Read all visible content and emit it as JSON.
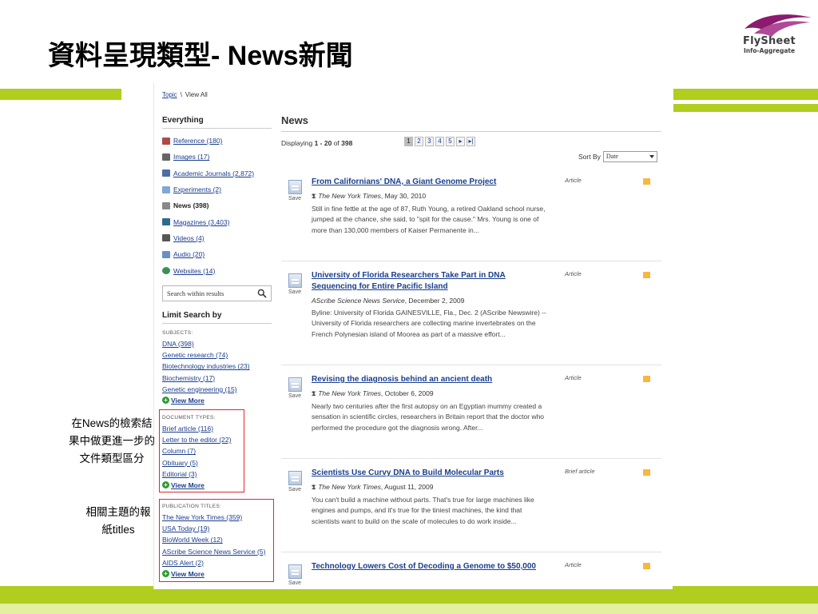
{
  "slide": {
    "title_cjk": "資料呈現類型",
    "title_latin": "- News",
    "title_cjk2": "新聞",
    "logo_name": "FlySheet",
    "logo_sub": "Info-Aggregate",
    "colors": {
      "bar": "#b1cd1e",
      "bar_light": "#e4ef9f",
      "logo": "#8c1a6e",
      "annotation_box": "#e0282c"
    }
  },
  "crumb": {
    "link": "Topic",
    "sep": "\\",
    "current": "View All"
  },
  "rail": {
    "title": "Everything",
    "items": [
      {
        "label": "Reference (180)",
        "icon": "reference-icon"
      },
      {
        "label": "Images (17)",
        "icon": "camera-icon"
      },
      {
        "label": "Academic Journals (2,872)",
        "icon": "journal-icon"
      },
      {
        "label": "Experiments (2)",
        "icon": "flask-icon"
      },
      {
        "label": "News (398)",
        "icon": "news-icon",
        "current": true
      },
      {
        "label": "Magazines (3,403)",
        "icon": "magazine-icon"
      },
      {
        "label": "Videos (4)",
        "icon": "video-icon"
      },
      {
        "label": "Audio (20)",
        "icon": "speaker-icon"
      },
      {
        "label": "Websites (14)",
        "icon": "globe-icon"
      }
    ]
  },
  "search": {
    "placeholder": "Search within results"
  },
  "limit": {
    "title": "Limit Search by",
    "subjects_head": "SUBJECTS:",
    "subjects": [
      "DNA (398)",
      "Genetic research (74)",
      "Biotechnology industries (23)",
      "Biochemistry (17)",
      "Genetic engineering (15)"
    ],
    "more": "View More",
    "doctypes_head": "DOCUMENT TYPES:",
    "doctypes": [
      "Brief article (116)",
      "Letter to the editor (22)",
      "Column (7)",
      "Obituary (5)",
      "Editorial (3)"
    ],
    "pubs_head": "PUBLICATION TITLES:",
    "pubs": [
      "The New York Times (359)",
      "USA Today (19)",
      "BioWorld Week (12)",
      "AScribe Science News Service (5)",
      "AIDS Alert (2)"
    ]
  },
  "main": {
    "heading": "News",
    "displaying_prefix": "Displaying ",
    "displaying_range": "1 - 20",
    "displaying_of": " of ",
    "displaying_total": "398",
    "pages": [
      "1",
      "2",
      "3",
      "4",
      "5",
      "▸",
      "▸|"
    ],
    "sort_label": "Sort By",
    "sort_value": "Date",
    "save_label": "Save",
    "results": [
      {
        "title": "From Californians' DNA, a Giant Genome Project",
        "source": "The New York Times",
        "date": ", May 30, 2010",
        "nyt": true,
        "abstract": "Still in fine fettle at the age of 87, Ruth Young, a retired Oakland school nurse, jumped at the chance, she said, to \"spit for the cause.\" Mrs. Young is one of more than 130,000 members of Kaiser Permanente in...",
        "kind": "Article"
      },
      {
        "title": "University of Florida Researchers Take Part in DNA Sequencing for Entire Pacific Island",
        "source": "AScribe Science News Service",
        "date": ", December 2, 2009",
        "nyt": false,
        "abstract": "Byline: University of Florida GAINESVILLE, Fla., Dec. 2 (AScribe Newswire) -- University of Florida researchers are collecting marine invertebrates on the French Polynesian island of Moorea as part of a massive effort...",
        "kind": "Article"
      },
      {
        "title": "Revising the diagnosis behind an ancient death",
        "source": "The New York Times",
        "date": ", October 6, 2009",
        "nyt": true,
        "abstract": "Nearly two centuries after the first autopsy on an Egyptian mummy created a sensation in scientific circles, researchers in Britain report that the doctor who performed the procedure got the diagnosis wrong. After...",
        "kind": "Article"
      },
      {
        "title": "Scientists Use Curvy DNA to Build Molecular Parts",
        "source": "The New York Times",
        "date": ", August 11, 2009",
        "nyt": true,
        "abstract": "You can't build a machine without parts. That's true for large machines like engines and pumps, and it's true for the tiniest machines, the kind that scientists want to build on the scale of molecules to do work inside...",
        "kind": "Brief article"
      },
      {
        "title": "Technology Lowers Cost of Decoding a Genome to $50,000",
        "source": "",
        "date": "",
        "nyt": false,
        "abstract": "",
        "kind": "Article"
      }
    ]
  },
  "notes": {
    "a_pre": "在",
    "a_latin": "News",
    "a_post": "的檢索結果中做更進一步的文件類型區分",
    "b_pre": "相關主題的報紙",
    "b_latin": "titles"
  }
}
